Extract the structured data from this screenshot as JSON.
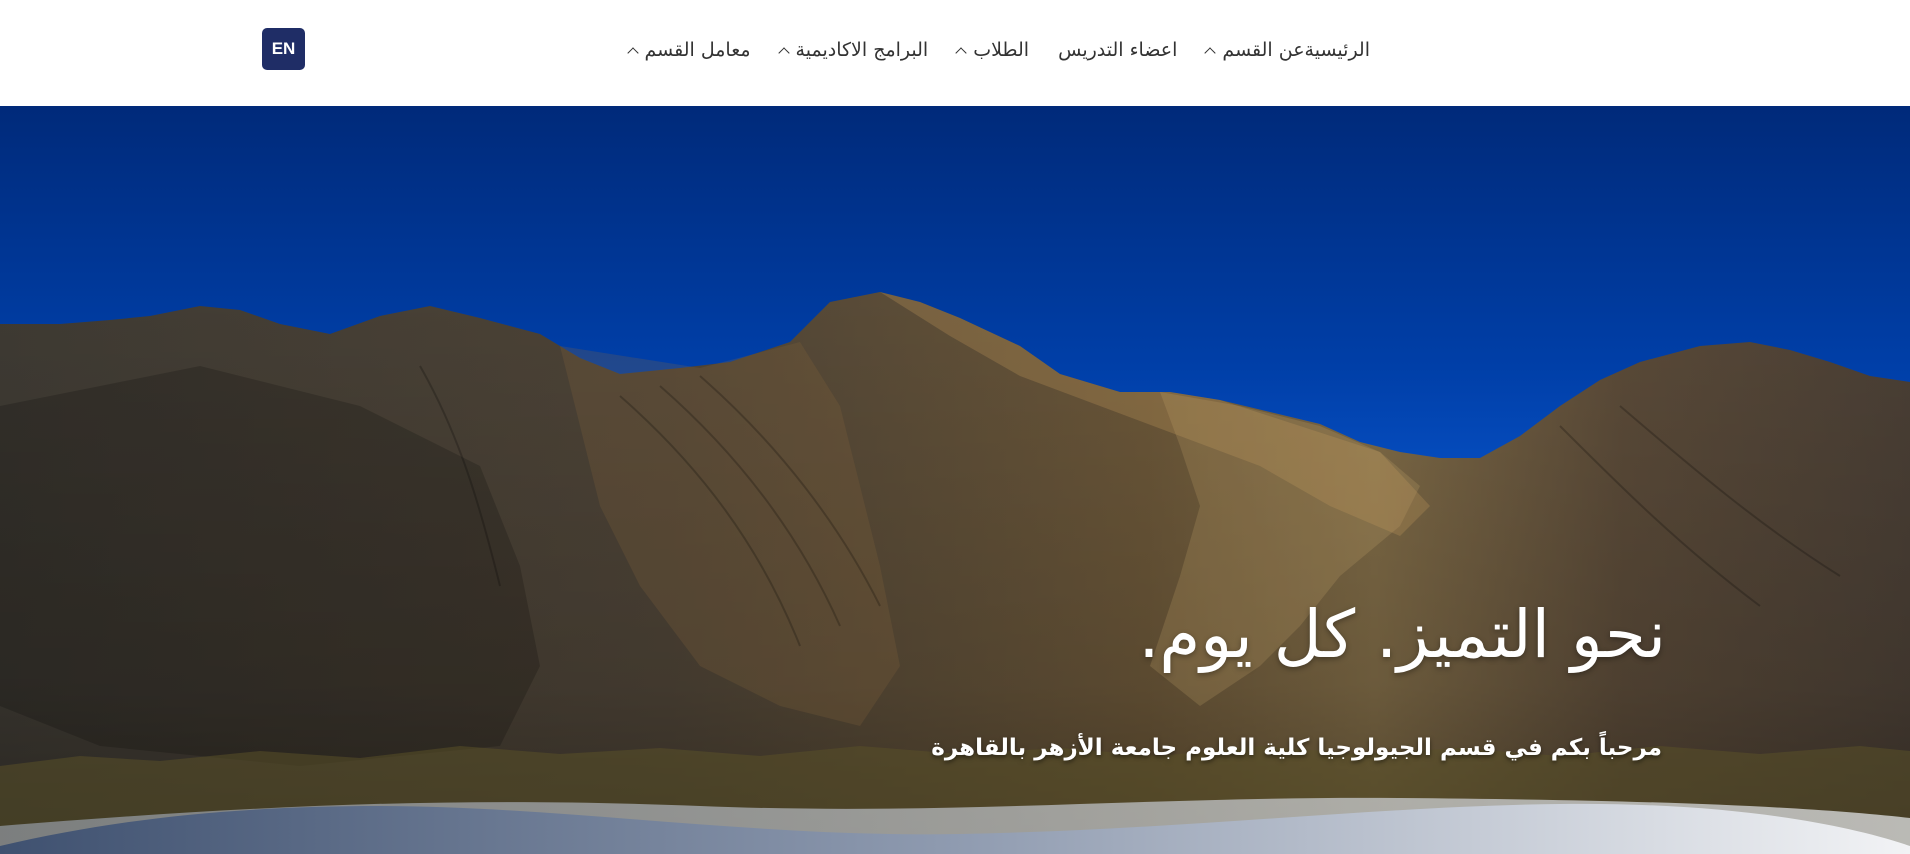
{
  "header": {
    "lang_button": "EN",
    "nav": [
      {
        "label": "الرئيسية",
        "dropdown": false
      },
      {
        "label": "عن القسم",
        "dropdown": true
      },
      {
        "label": "اعضاء التدريس",
        "dropdown": false
      },
      {
        "label": "الطلاب",
        "dropdown": true
      },
      {
        "label": "البرامج الاكاديمية",
        "dropdown": true
      },
      {
        "label": "معامل القسم",
        "dropdown": true
      }
    ]
  },
  "hero": {
    "title": "نحو التميز. كل يوم.",
    "subtitle": "مرحباً بكم في قسم الجيولوجيا كلية العلوم جامعة الأزهر بالقاهرة"
  },
  "colors": {
    "brand": "#1f2d66",
    "sky": "#0a57d0",
    "text": "#333333"
  }
}
